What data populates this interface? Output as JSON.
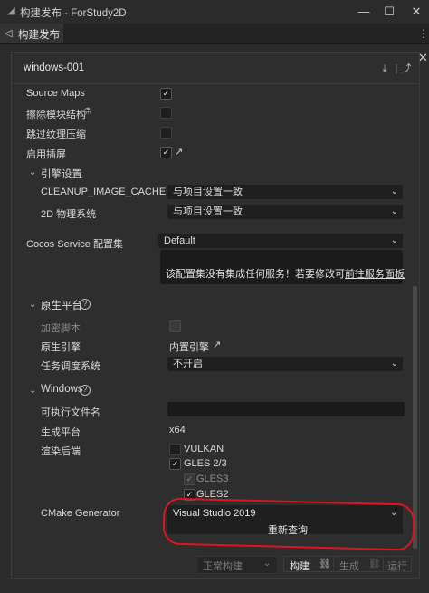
{
  "window": {
    "title": "构建发布 - ForStudy2D",
    "tab_label": "构建发布"
  },
  "panel": {
    "title": "windows-001"
  },
  "rows": {
    "source_maps": {
      "label": "Source Maps",
      "checked": true
    },
    "erase_module": {
      "label": "擦除模块结构",
      "checked": false
    },
    "skip_texture": {
      "label": "跳过纹理压缩",
      "checked": false
    },
    "splash": {
      "label": "启用插屏",
      "checked": true
    },
    "engine_section": "引擎设置",
    "cleanup_cache": {
      "label": "CLEANUP_IMAGE_CACHE",
      "value": "与项目设置一致"
    },
    "physics_2d": {
      "label": "2D 物理系统",
      "value": "与项目设置一致"
    },
    "cocos_service": {
      "label": "Cocos Service 配置集",
      "value": "Default"
    },
    "service_tip": {
      "text": "该配置集没有集成任何服务！若要修改可",
      "link": "前往服务面板"
    },
    "native_section": "原生平台",
    "encrypt": {
      "label": "加密脚本"
    },
    "native_engine": {
      "label": "原生引擎",
      "value": "内置引擎"
    },
    "task_scheduler": {
      "label": "任务调度系统",
      "value": "不开启"
    },
    "windows_section": "Windows",
    "exe_name": {
      "label": "可执行文件名",
      "value": ""
    },
    "gen_platform": {
      "label": "生成平台",
      "value": "x64"
    },
    "render_backend": {
      "label": "渲染后端",
      "vulkan": "VULKAN",
      "gles23": "GLES 2/3",
      "gles3": "GLES3",
      "gles2": "GLES2"
    },
    "cmake": {
      "label": "CMake Generator",
      "value": "Visual Studio 2019",
      "requery": "重新查询"
    }
  },
  "footer": {
    "normal_build": "正常构建",
    "build": "构建",
    "generate": "生成",
    "run": "运行"
  }
}
